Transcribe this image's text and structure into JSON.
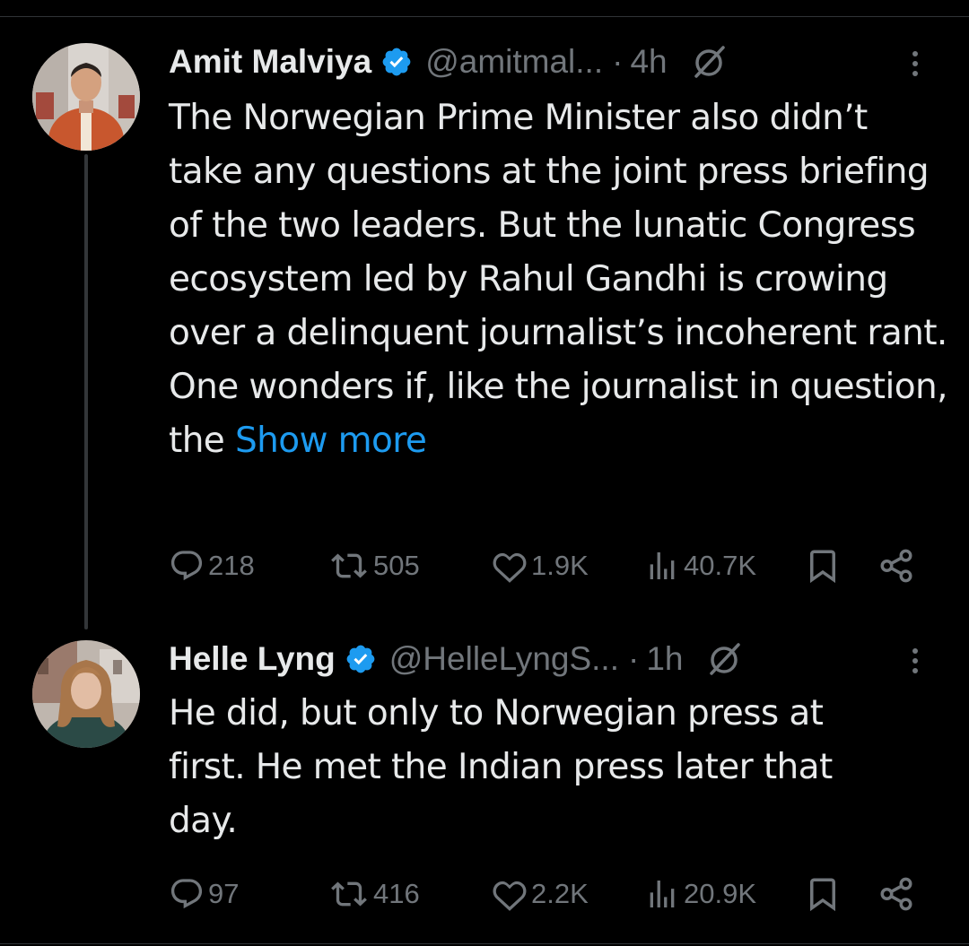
{
  "tweets": [
    {
      "name": "Amit Malviya",
      "handle": "@amitmal...",
      "dot": "·",
      "time": "4h",
      "text": "The Norwegian Prime Minister also didn’t take any questions at the joint press briefing of the two leaders. But the lunatic Congress ecosystem led by Rahul Gandhi is crowing over a delinquent journalist’s incoherent rant. One wonders if, like the journalist in question, the",
      "show_more": "Show more",
      "replies": "218",
      "reposts": "505",
      "likes": "1.9K",
      "views": "40.7K"
    },
    {
      "name": "Helle Lyng",
      "handle": "@HelleLyngS...",
      "dot": "·",
      "time": "1h",
      "text": "He did, but only to Norwegian press at first. He met the Indian press later that day.",
      "replies": "97",
      "reposts": "416",
      "likes": "2.2K",
      "views": "20.9K"
    }
  ],
  "icons": {
    "verified": "verified-badge-icon",
    "grok": "grok-icon",
    "more": "more-icon",
    "reply": "reply-icon",
    "repost": "repost-icon",
    "like": "like-icon",
    "views": "views-icon",
    "bookmark": "bookmark-icon",
    "share": "share-icon"
  },
  "colors": {
    "background": "#000000",
    "text": "#e7e9ea",
    "secondary": "#71767b",
    "link": "#1d9bf0",
    "verified": "#1d9bf0",
    "divider": "#2f3336"
  }
}
